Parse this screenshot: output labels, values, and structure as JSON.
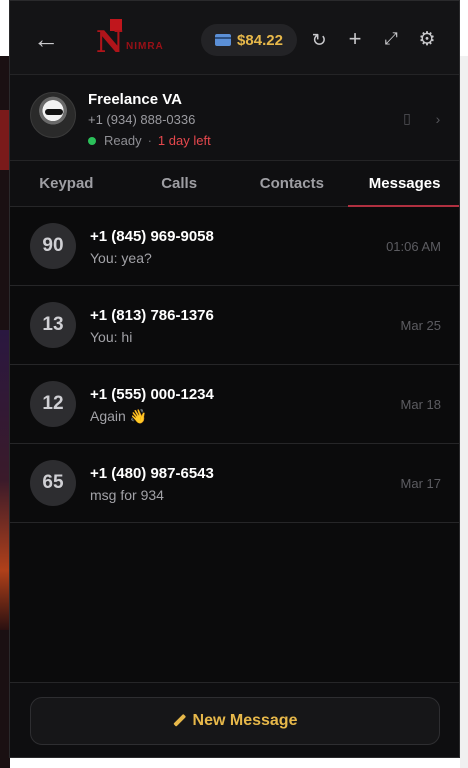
{
  "topbar": {
    "back_icon": "arrow-left-icon",
    "logo_text": "NIMRA",
    "balance": "$84.22",
    "icons": [
      "refresh-icon",
      "plus-icon",
      "expand-icon",
      "gear-icon"
    ]
  },
  "profile": {
    "name": "Freelance VA",
    "number": "+1 (934) 888-0336",
    "status": "Ready",
    "separator": "·",
    "days_left": "1 day left",
    "status_color": "#2bc05a",
    "days_color": "#e5484d"
  },
  "tabs": [
    {
      "label": "Keypad",
      "active": false
    },
    {
      "label": "Calls",
      "active": false
    },
    {
      "label": "Contacts",
      "active": false
    },
    {
      "label": "Messages",
      "active": true
    }
  ],
  "messages": [
    {
      "badge": "90",
      "phone": "+1 (845) 969-9058",
      "preview": "You: yea?",
      "time": "01:06 AM"
    },
    {
      "badge": "13",
      "phone": "+1 (813) 786-1376",
      "preview": "You: hi",
      "time": "Mar 25"
    },
    {
      "badge": "12",
      "phone": "+1 (555) 000-1234",
      "preview": "Again 👋",
      "time": "Mar 18"
    },
    {
      "badge": "65",
      "phone": "+1 (480) 987-6543",
      "preview": "msg for 934",
      "time": "Mar 17"
    }
  ],
  "footer": {
    "new_message_label": "New Message"
  },
  "colors": {
    "accent_gold": "#e7b84a",
    "brand_red": "#b0141a",
    "tab_underline": "#b03040"
  }
}
